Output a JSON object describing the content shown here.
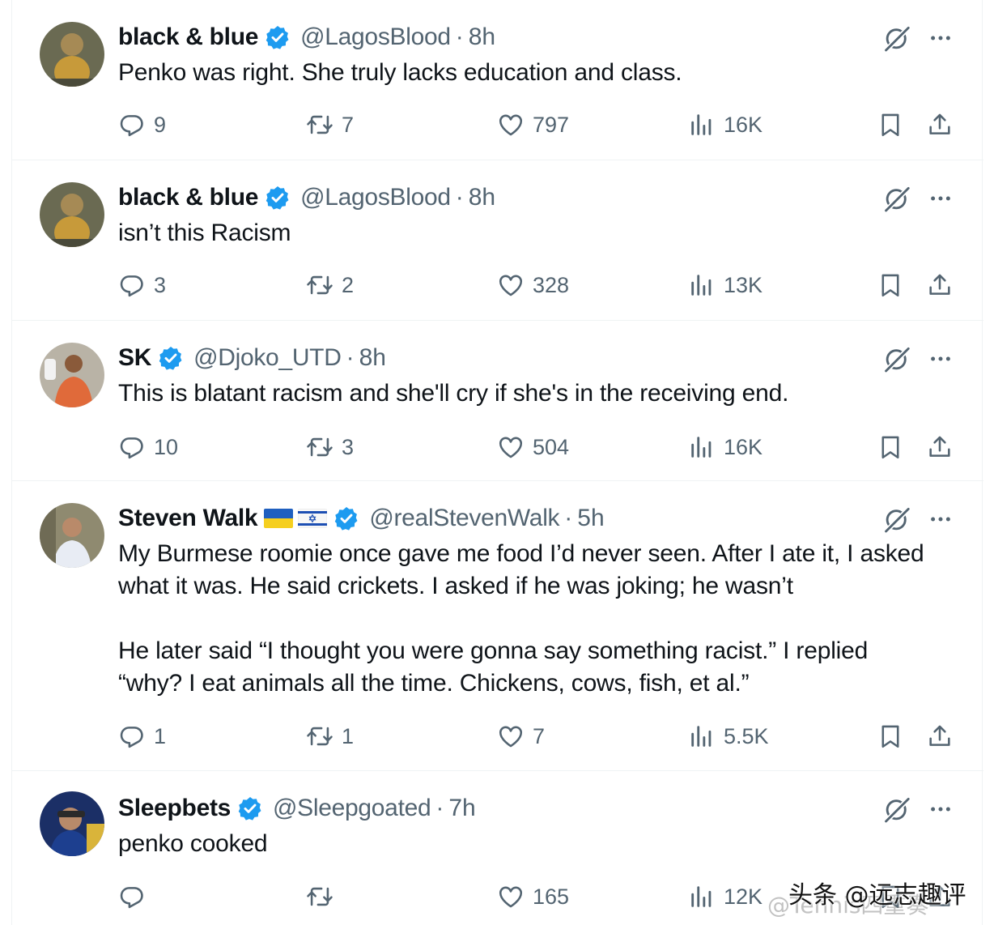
{
  "tweets": [
    {
      "name": "black & blue",
      "handle": "@LagosBlood",
      "sep": "·",
      "time": "8h",
      "text": "Penko was right. She truly lacks education and class.",
      "replies": "9",
      "reposts": "7",
      "likes": "797",
      "views": "16K"
    },
    {
      "name": "black & blue",
      "handle": "@LagosBlood",
      "sep": "·",
      "time": "8h",
      "text": "isn’t this Racism",
      "replies": "3",
      "reposts": "2",
      "likes": "328",
      "views": "13K"
    },
    {
      "name": "SK",
      "handle": "@Djoko_UTD",
      "sep": "·",
      "time": "8h",
      "text": "This is blatant racism and she'll cry if she's in the receiving end.",
      "replies": "10",
      "reposts": "3",
      "likes": "504",
      "views": "16K"
    },
    {
      "name": "Steven Walk",
      "flags": [
        "ukraine-flag",
        "israel-flag"
      ],
      "handle": "@realStevenWalk",
      "sep": "·",
      "time": "5h",
      "text": "My Burmese roomie once gave me food I’d never seen. After I ate it, I asked\nwhat it was. He said crickets. I asked if he was joking; he wasn’t\n\nHe later said “I thought you were gonna say something racist.” I replied\n“why? I eat animals all the time. Chickens, cows, fish, et al.”",
      "replies": "1",
      "reposts": "1",
      "likes": "7",
      "views": "5.5K"
    },
    {
      "name": "Sleepbets",
      "handle": "@Sleepgoated",
      "sep": "·",
      "time": "7h",
      "text": "penko cooked",
      "replies": "",
      "reposts": "",
      "likes": "165",
      "views": "12K"
    }
  ],
  "watermark": "头条 @远志趣评",
  "watermark_faint": "@Tennis四重奏",
  "colors": {
    "verified": "#1d9bf0",
    "muted": "#536471",
    "text": "#0f1419",
    "divider": "#eff3f4"
  },
  "icons": [
    "reply-icon",
    "repost-icon",
    "like-icon",
    "views-icon",
    "bookmark-icon",
    "share-icon",
    "grok-icon",
    "more-icon",
    "verified-badge-icon"
  ]
}
